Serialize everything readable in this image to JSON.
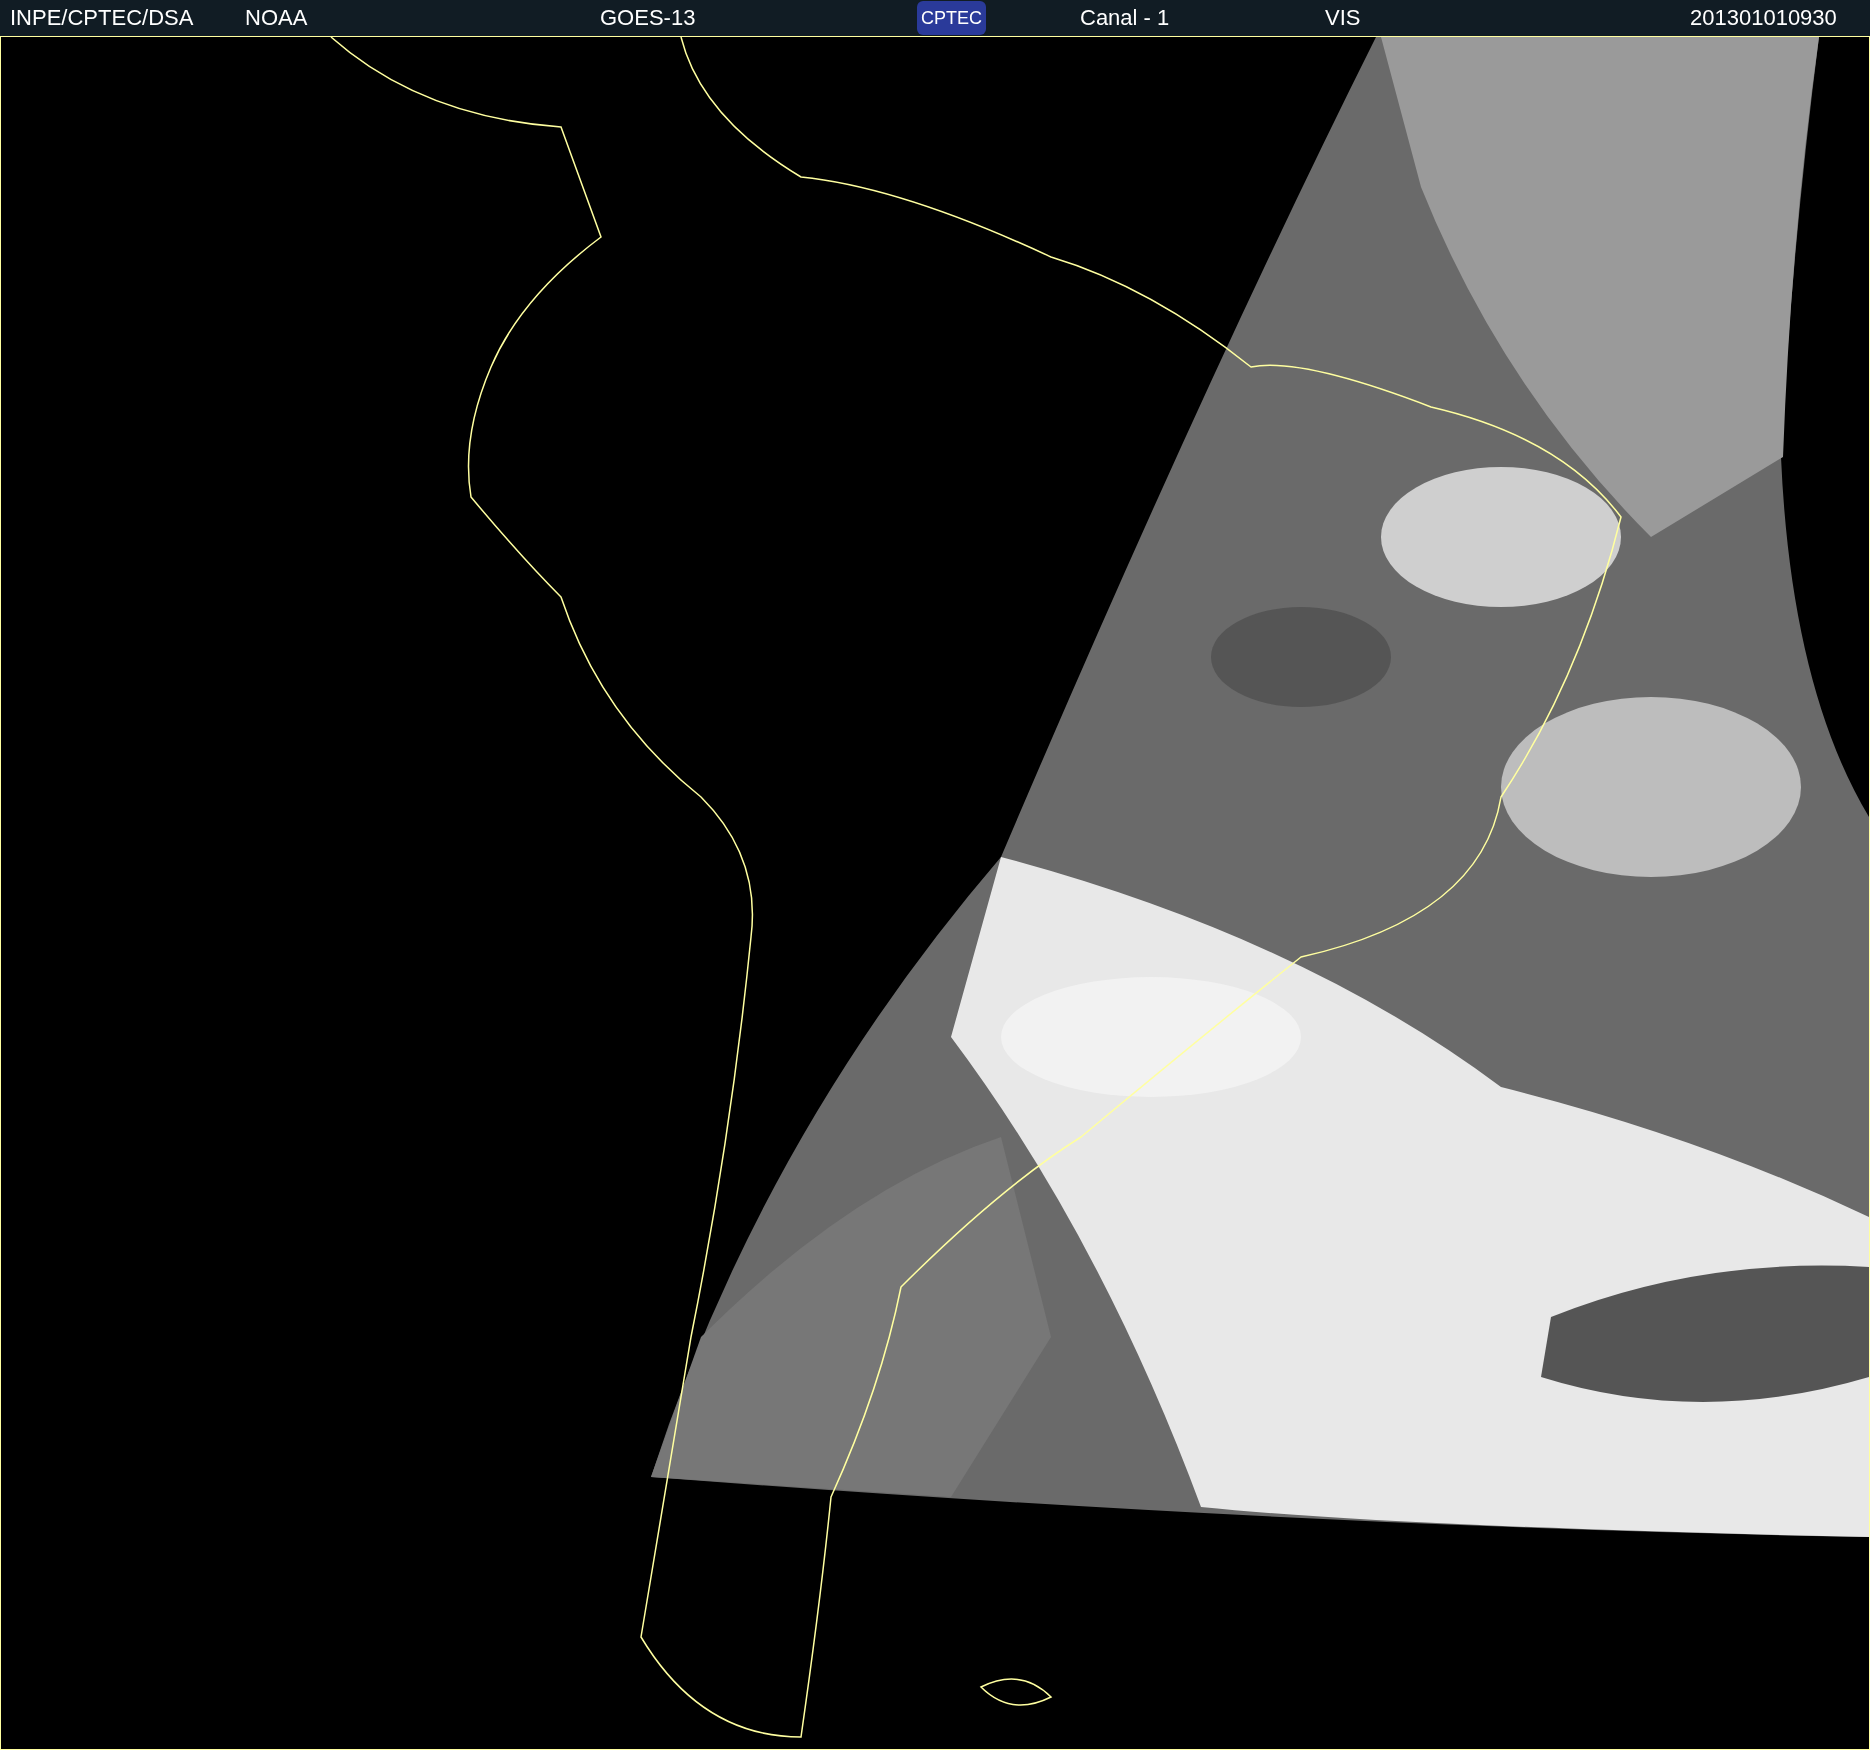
{
  "header": {
    "items": [
      {
        "kind": "text",
        "text": "INPE/CPTEC/DSA"
      },
      {
        "kind": "text",
        "text": "NOAA"
      },
      {
        "kind": "text",
        "text": "GOES-13"
      },
      {
        "kind": "logo",
        "text": "CPTEC"
      },
      {
        "kind": "text",
        "text": "Canal - 1"
      },
      {
        "kind": "text",
        "text": "VIS"
      },
      {
        "kind": "text",
        "text": "201301010930"
      }
    ]
  }
}
